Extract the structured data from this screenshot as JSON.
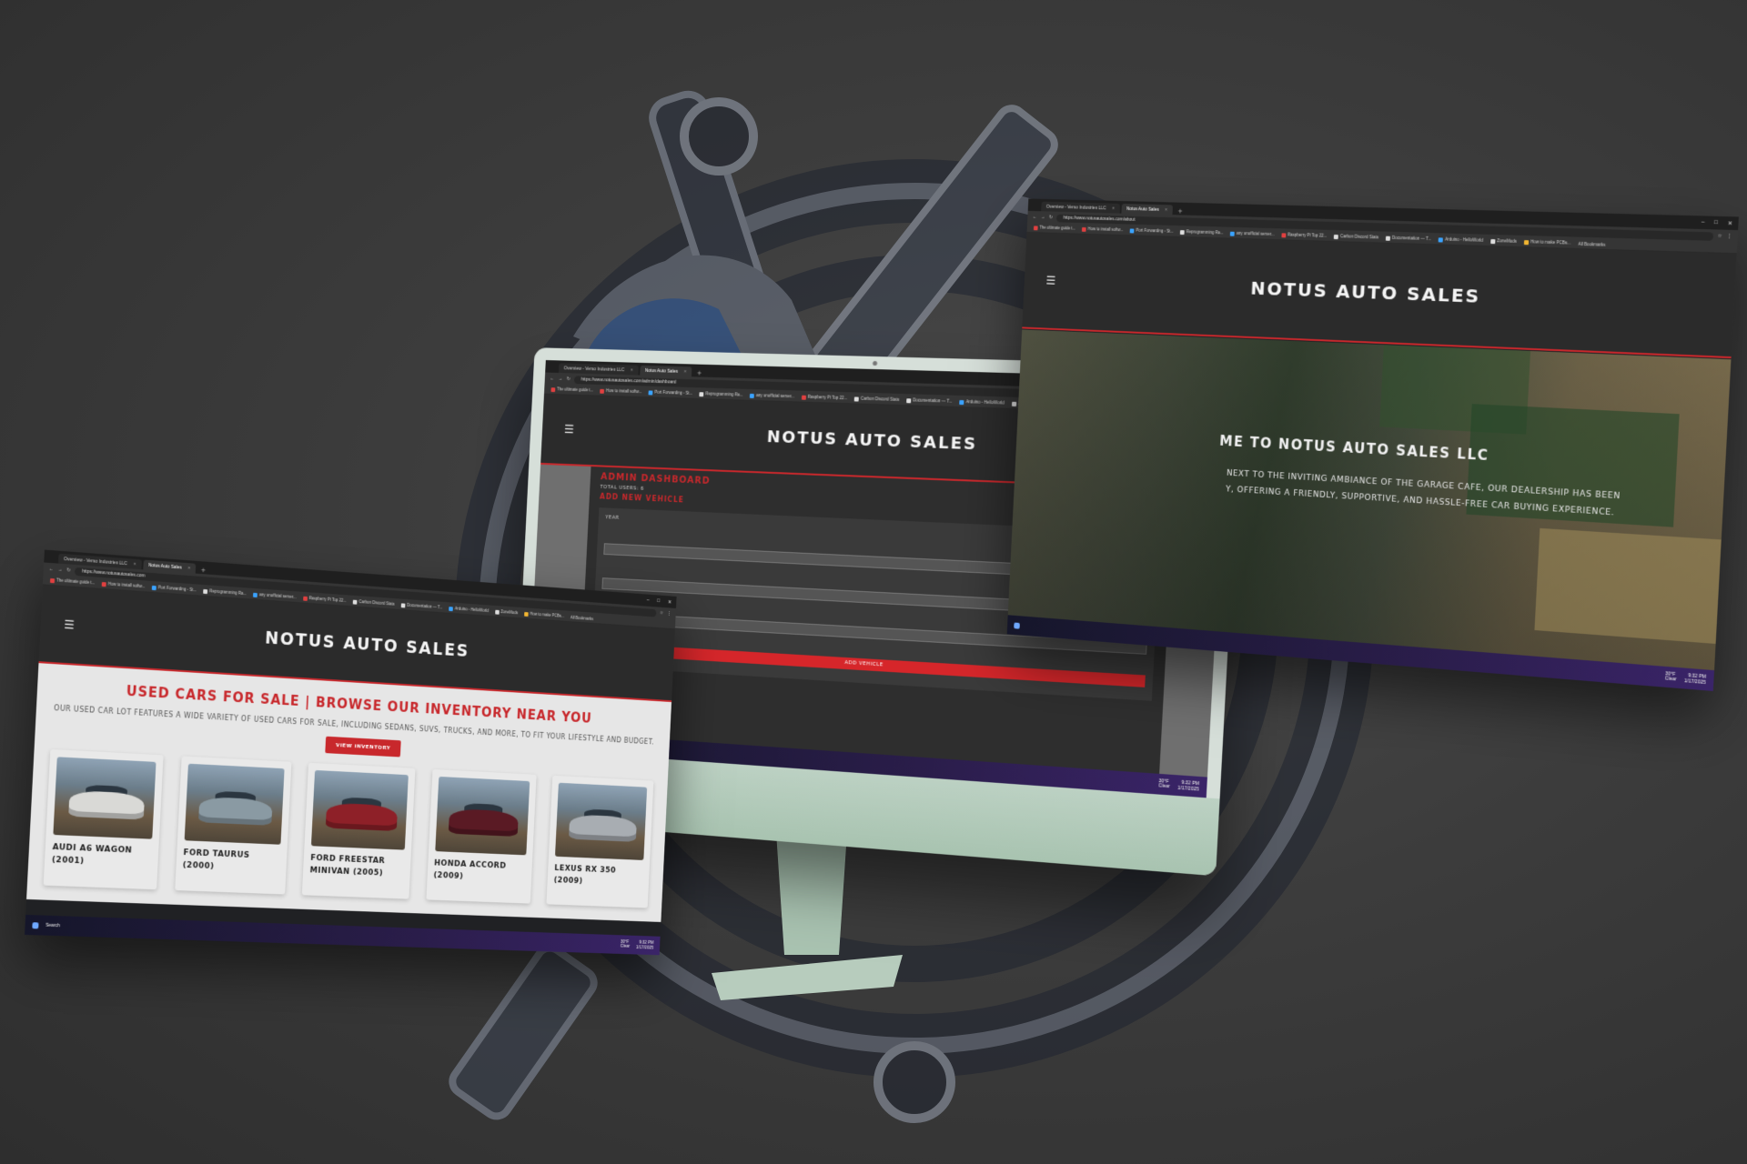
{
  "colors": {
    "brand_red": "#c8282c",
    "header_dark": "#2b2b2b",
    "imac_green": "#b9d0c1"
  },
  "site": {
    "title": "NOTUS AUTO SALES",
    "hamburger_icon": "menu-icon"
  },
  "browser": {
    "tabs": [
      "Overview - Verso Industries LLC",
      "Notus Auto Sales"
    ],
    "bookmarks": [
      "The ultimate guide t...",
      "How to install softw...",
      "Port Forwarding - St...",
      "Reprogramming Ra...",
      "any unofficial server...",
      "Raspberry Pi Top 22...",
      "Carbon Discord Stats",
      "Documentation — T...",
      "Arduino - HelloWorld",
      "ZoneMods",
      "How to make PCBs..."
    ],
    "all_bookmarks": "All Bookmarks"
  },
  "taskbar": {
    "search": "Search",
    "temp": "30°F",
    "weather": "Clear",
    "time": "9:32 PM",
    "date": "1/17/2025"
  },
  "window_home": {
    "url": "https://www.notusautosales.com",
    "heading": "USED CARS FOR SALE | BROWSE OUR INVENTORY NEAR YOU",
    "subtext": "OUR USED CAR LOT FEATURES A WIDE VARIETY OF USED CARS FOR SALE, INCLUDING SEDANS, SUVS, TRUCKS, AND MORE, TO FIT YOUR LIFESTYLE AND BUDGET.",
    "button": "VIEW INVENTORY",
    "cars": [
      {
        "name": "AUDI A6 WAGON (2001)",
        "color": "#d9d9d6"
      },
      {
        "name": "FORD TAURUS (2000)",
        "color": "#8a9aa3"
      },
      {
        "name": "FORD FREESTAR MINIVAN (2005)",
        "color": "#8e2028"
      },
      {
        "name": "HONDA ACCORD (2009)",
        "color": "#5a1a24"
      },
      {
        "name": "LEXUS RX 350 (2009)",
        "color": "#a8adb2"
      }
    ]
  },
  "window_admin": {
    "url": "https://www.notusautosales.com/admin/dashboard",
    "title": "ADMIN DASHBOARD",
    "total_users": "TOTAL USERS: 6",
    "add_vehicle_heading": "ADD NEW VEHICLE",
    "year_label": "YEAR",
    "submit": "ADD VEHICLE"
  },
  "window_about": {
    "url": "https://www.notusautosales.com/about",
    "welcome": "ME TO NOTUS AUTO SALES LLC",
    "copy_line1": "NEXT TO THE INVITING AMBIANCE OF THE GARAGE CAFE, OUR DEALERSHIP HAS BEEN",
    "copy_line2": "Y, OFFERING A FRIENDLY, SUPPORTIVE, AND HASSLE-FREE CAR BUYING EXPERIENCE."
  }
}
